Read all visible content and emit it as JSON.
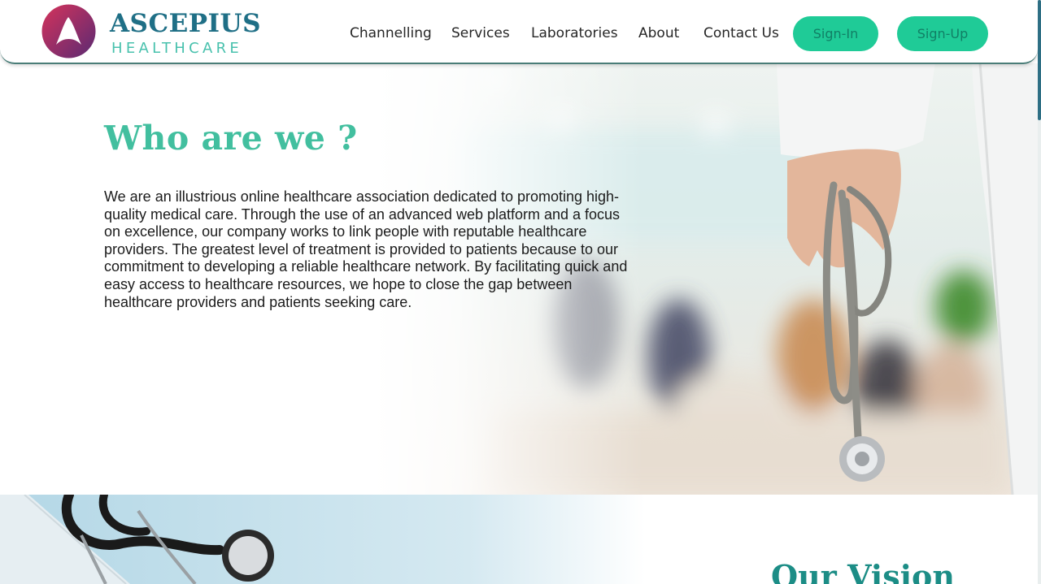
{
  "brand": {
    "name": "ASCEPIUS",
    "tagline": "HEALTHCARE",
    "logo_icon": "stylized-a-logo-icon",
    "colors": {
      "primary": "#1f6f86",
      "accent": "#48c1ad",
      "gradient_start": "#d5335b",
      "gradient_end": "#5a2a73"
    }
  },
  "nav": {
    "items": [
      {
        "label": "Channelling"
      },
      {
        "label": "Services"
      },
      {
        "label": "Laboratories"
      },
      {
        "label": "About"
      },
      {
        "label": "Contact Us"
      }
    ],
    "signin_label": "Sign-In",
    "signup_label": "Sign-Up",
    "button_color": "#1fcb97"
  },
  "hero": {
    "title": "Who are we ?",
    "body": "We are an illustrious online healthcare association dedicated to promoting high-quality medical care. Through the use of an advanced web platform and a focus on excellence, our company works to link people with reputable healthcare providers. The greatest level of treatment is provided to patients because to our commitment to developing a reliable healthcare network. By facilitating quick and easy access to healthcare resources, we hope to close the gap between healthcare providers and patients seeking care.",
    "image": "doctor-holding-stethoscope-photo"
  },
  "vision": {
    "title": "Our Vision",
    "image": "stethoscope-on-blue-background-photo"
  }
}
